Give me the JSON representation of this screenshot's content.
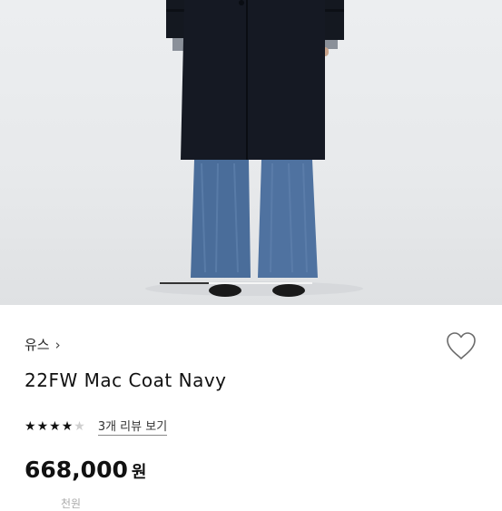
{
  "gallery": {
    "progress_fraction": 0.32
  },
  "product": {
    "brand": "유스",
    "brand_chevron": "›",
    "name": "22FW Mac Coat Navy",
    "rating_stars": 4,
    "rating_max": 5,
    "reviews_link": "3개 리뷰 보기",
    "price": "668,000",
    "price_unit": "원",
    "cutoff_line": [
      "",
      "",
      "천원"
    ]
  },
  "colors": {
    "coat": "#141820",
    "denim": "#4a6d9a",
    "star_filled": "#111111",
    "star_empty": "#cfcfcf"
  },
  "icons": {
    "wishlist": "heart-outline-icon",
    "brand_arrow": "chevron-right-icon",
    "star": "star-icon"
  }
}
